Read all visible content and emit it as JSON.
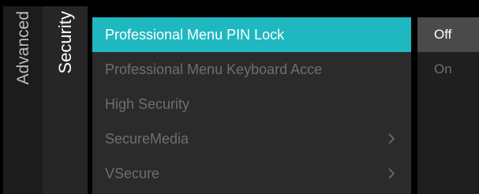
{
  "breadcrumb": {
    "parent": "Advanced",
    "current": "Security"
  },
  "menu": {
    "items": [
      {
        "label": "Professional Menu PIN Lock",
        "selected": true,
        "has_submenu": false
      },
      {
        "label": "Professional Menu Keyboard Acce",
        "selected": false,
        "has_submenu": false
      },
      {
        "label": "High Security",
        "selected": false,
        "has_submenu": false
      },
      {
        "label": "SecureMedia",
        "selected": false,
        "has_submenu": true
      },
      {
        "label": "VSecure",
        "selected": false,
        "has_submenu": true
      }
    ]
  },
  "options": {
    "items": [
      {
        "label": "Off",
        "active": true
      },
      {
        "label": "On",
        "active": false
      }
    ]
  },
  "colors": {
    "accent": "#20b8c0",
    "background": "#000000",
    "menu_bg": "#2b2b2b",
    "text_inactive": "#6e6e6e"
  },
  "icons": {
    "submenu": "chevron-right-icon"
  }
}
